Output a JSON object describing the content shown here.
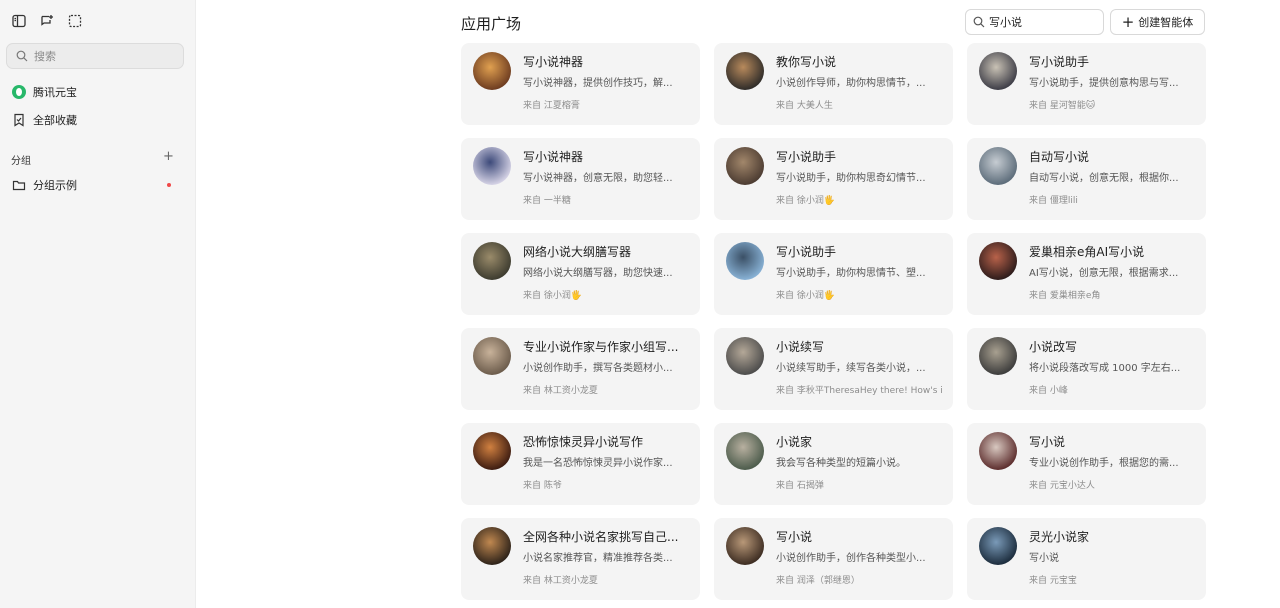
{
  "sidebar": {
    "search_placeholder": "搜索",
    "nav": [
      {
        "label": "腾讯元宝",
        "icon": "yuanbao-logo-icon"
      },
      {
        "label": "全部收藏",
        "icon": "bookmark-icon"
      }
    ],
    "group_title": "分组",
    "group_add": "+",
    "groups": [
      {
        "label": "分组示例",
        "icon": "folder-icon"
      }
    ]
  },
  "main": {
    "title": "应用广场",
    "search_value": "写小说",
    "create_label": "创建智能体"
  },
  "colors": {
    "accent_green": "#28b86a",
    "red_dot": "#f04848",
    "card_bg": "#f4f4f4"
  },
  "cards": [
    {
      "title": "写小说神器",
      "desc": "写小说神器，提供创作技巧，解...",
      "source": "来自 江夏榕膏"
    },
    {
      "title": "教你写小说",
      "desc": "小说创作导师，助你构思情节，...",
      "source": "来自 大美人生"
    },
    {
      "title": "写小说助手",
      "desc": "写小说助手，提供创意构思与写...",
      "source": "来自 星河智能🐱"
    },
    {
      "title": "写小说神器",
      "desc": "写小说神器，创意无限，助您轻...",
      "source": "来自 一半糖"
    },
    {
      "title": "写小说助手",
      "desc": "写小说助手，助你构思奇幻情节...",
      "source": "来自 徐小润🖐"
    },
    {
      "title": "自动写小说",
      "desc": "自动写小说，创意无限，根据你...",
      "source": "来自 僵理lili"
    },
    {
      "title": "网络小说大纲膳写器",
      "desc": "网络小说大纲膳写器，助您快速...",
      "source": "来自 徐小润🖐"
    },
    {
      "title": "写小说助手",
      "desc": "写小说助手，助你构思情节、塑...",
      "source": "来自 徐小润🖐"
    },
    {
      "title": "爱巢相亲e角AI写小说",
      "desc": "AI写小说，创意无限，根据需求...",
      "source": "来自 爱巢相亲e角"
    },
    {
      "title": "专业小说作家与作家小组写...",
      "desc": "小说创作助手，撰写各类题材小...",
      "source": "来自 林工资小龙夏"
    },
    {
      "title": "小说续写",
      "desc": "小说续写助手，续写各类小说，...",
      "source": "来自 李秋平TheresaHey there! How's it"
    },
    {
      "title": "小说改写",
      "desc": "将小说段落改写成 1000 字左右...",
      "source": "来自 小峰"
    },
    {
      "title": "恐怖惊悚灵异小说写作",
      "desc": "我是一名恐怖惊悚灵异小说作家...",
      "source": "来自 陈爷"
    },
    {
      "title": "小说家",
      "desc": "我会写各种类型的短篇小说。",
      "source": "来自 石揭弹"
    },
    {
      "title": "写小说",
      "desc": "专业小说创作助手，根据您的需...",
      "source": "来自 元宝小达人"
    },
    {
      "title": "全网各种小说名家挑写自己...",
      "desc": "小说名家推荐官，精准推荐各类...",
      "source": "来自 林工资小龙夏"
    },
    {
      "title": "写小说",
      "desc": "小说创作助手，创作各种类型小...",
      "source": "来自 润泽（郭继恩）"
    },
    {
      "title": "灵光小说家",
      "desc": "写小说",
      "source": "来自 元宝宝"
    }
  ]
}
